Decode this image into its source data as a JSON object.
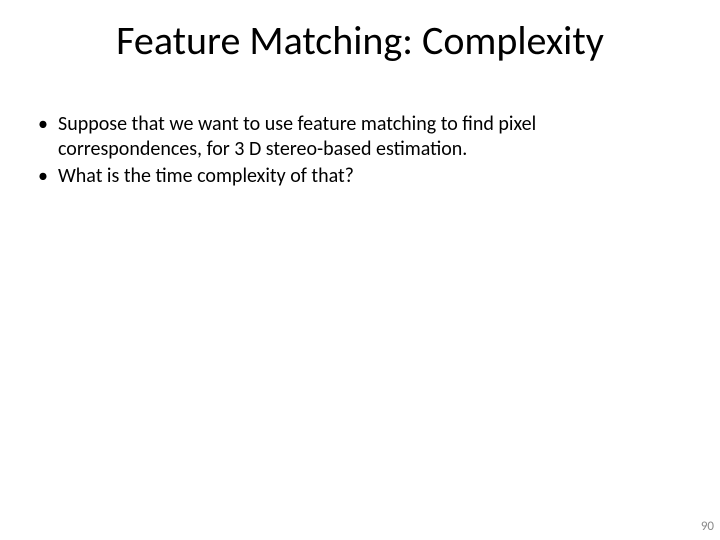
{
  "slide": {
    "title": "Feature Matching: Complexity",
    "bullets": [
      "Suppose that we want to use feature matching to find pixel correspondences, for 3 D stereo-based estimation.",
      "What is the time complexity of that?"
    ],
    "page_number": "90"
  }
}
